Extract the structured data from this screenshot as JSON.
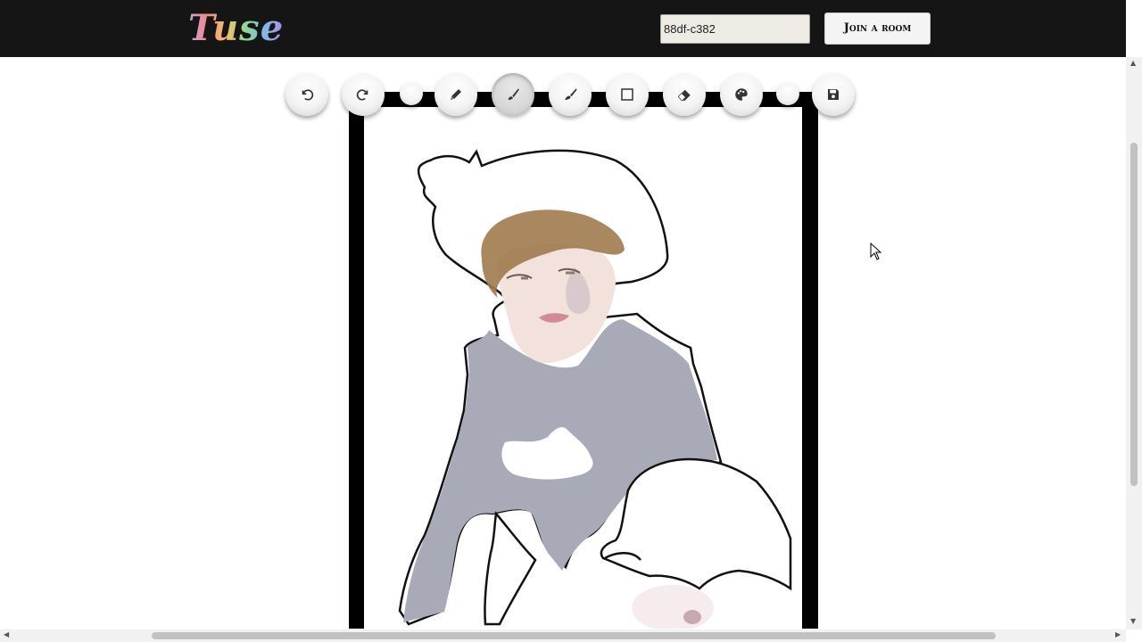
{
  "app": {
    "logo_text": "Tuse"
  },
  "room": {
    "code_value": "88df-c382",
    "join_label": "Join a room"
  },
  "toolbar": {
    "tools": [
      {
        "name": "undo-icon"
      },
      {
        "name": "redo-icon"
      },
      {
        "name": "size-small-icon"
      },
      {
        "name": "pencil-icon"
      },
      {
        "name": "brush-icon",
        "active": true
      },
      {
        "name": "paintbrush-icon"
      },
      {
        "name": "rectangle-icon"
      },
      {
        "name": "eraser-icon"
      },
      {
        "name": "palette-icon"
      },
      {
        "name": "color-swatch-icon"
      },
      {
        "name": "save-icon"
      }
    ]
  },
  "colors": {
    "header_bg": "#151515",
    "frame": "#000000",
    "sweater": "#a9aab8",
    "hair": "#a07a4e",
    "skin": "#f1dcd6",
    "lips": "#d48a96"
  }
}
